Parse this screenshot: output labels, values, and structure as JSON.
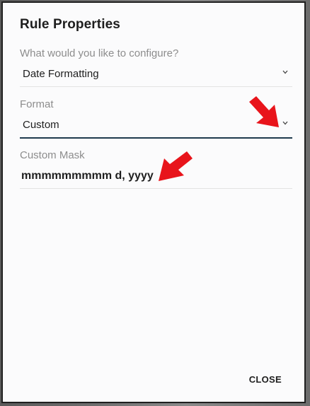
{
  "dialog": {
    "title": "Rule Properties",
    "close_label": "CLOSE"
  },
  "fields": {
    "configure": {
      "label": "What would you like to configure?",
      "value": "Date Formatting"
    },
    "format": {
      "label": "Format",
      "value": "Custom"
    },
    "custom_mask": {
      "label": "Custom Mask",
      "value": "mmmmmmmmm d, yyyy"
    }
  },
  "colors": {
    "annotation_arrow": "#e8141b",
    "focus_underline": "#1f3a4d"
  },
  "icons": {
    "configure_dropdown": "chevron-down-icon",
    "format_dropdown": "chevron-down-icon",
    "annotation": "red-arrow-icon"
  }
}
